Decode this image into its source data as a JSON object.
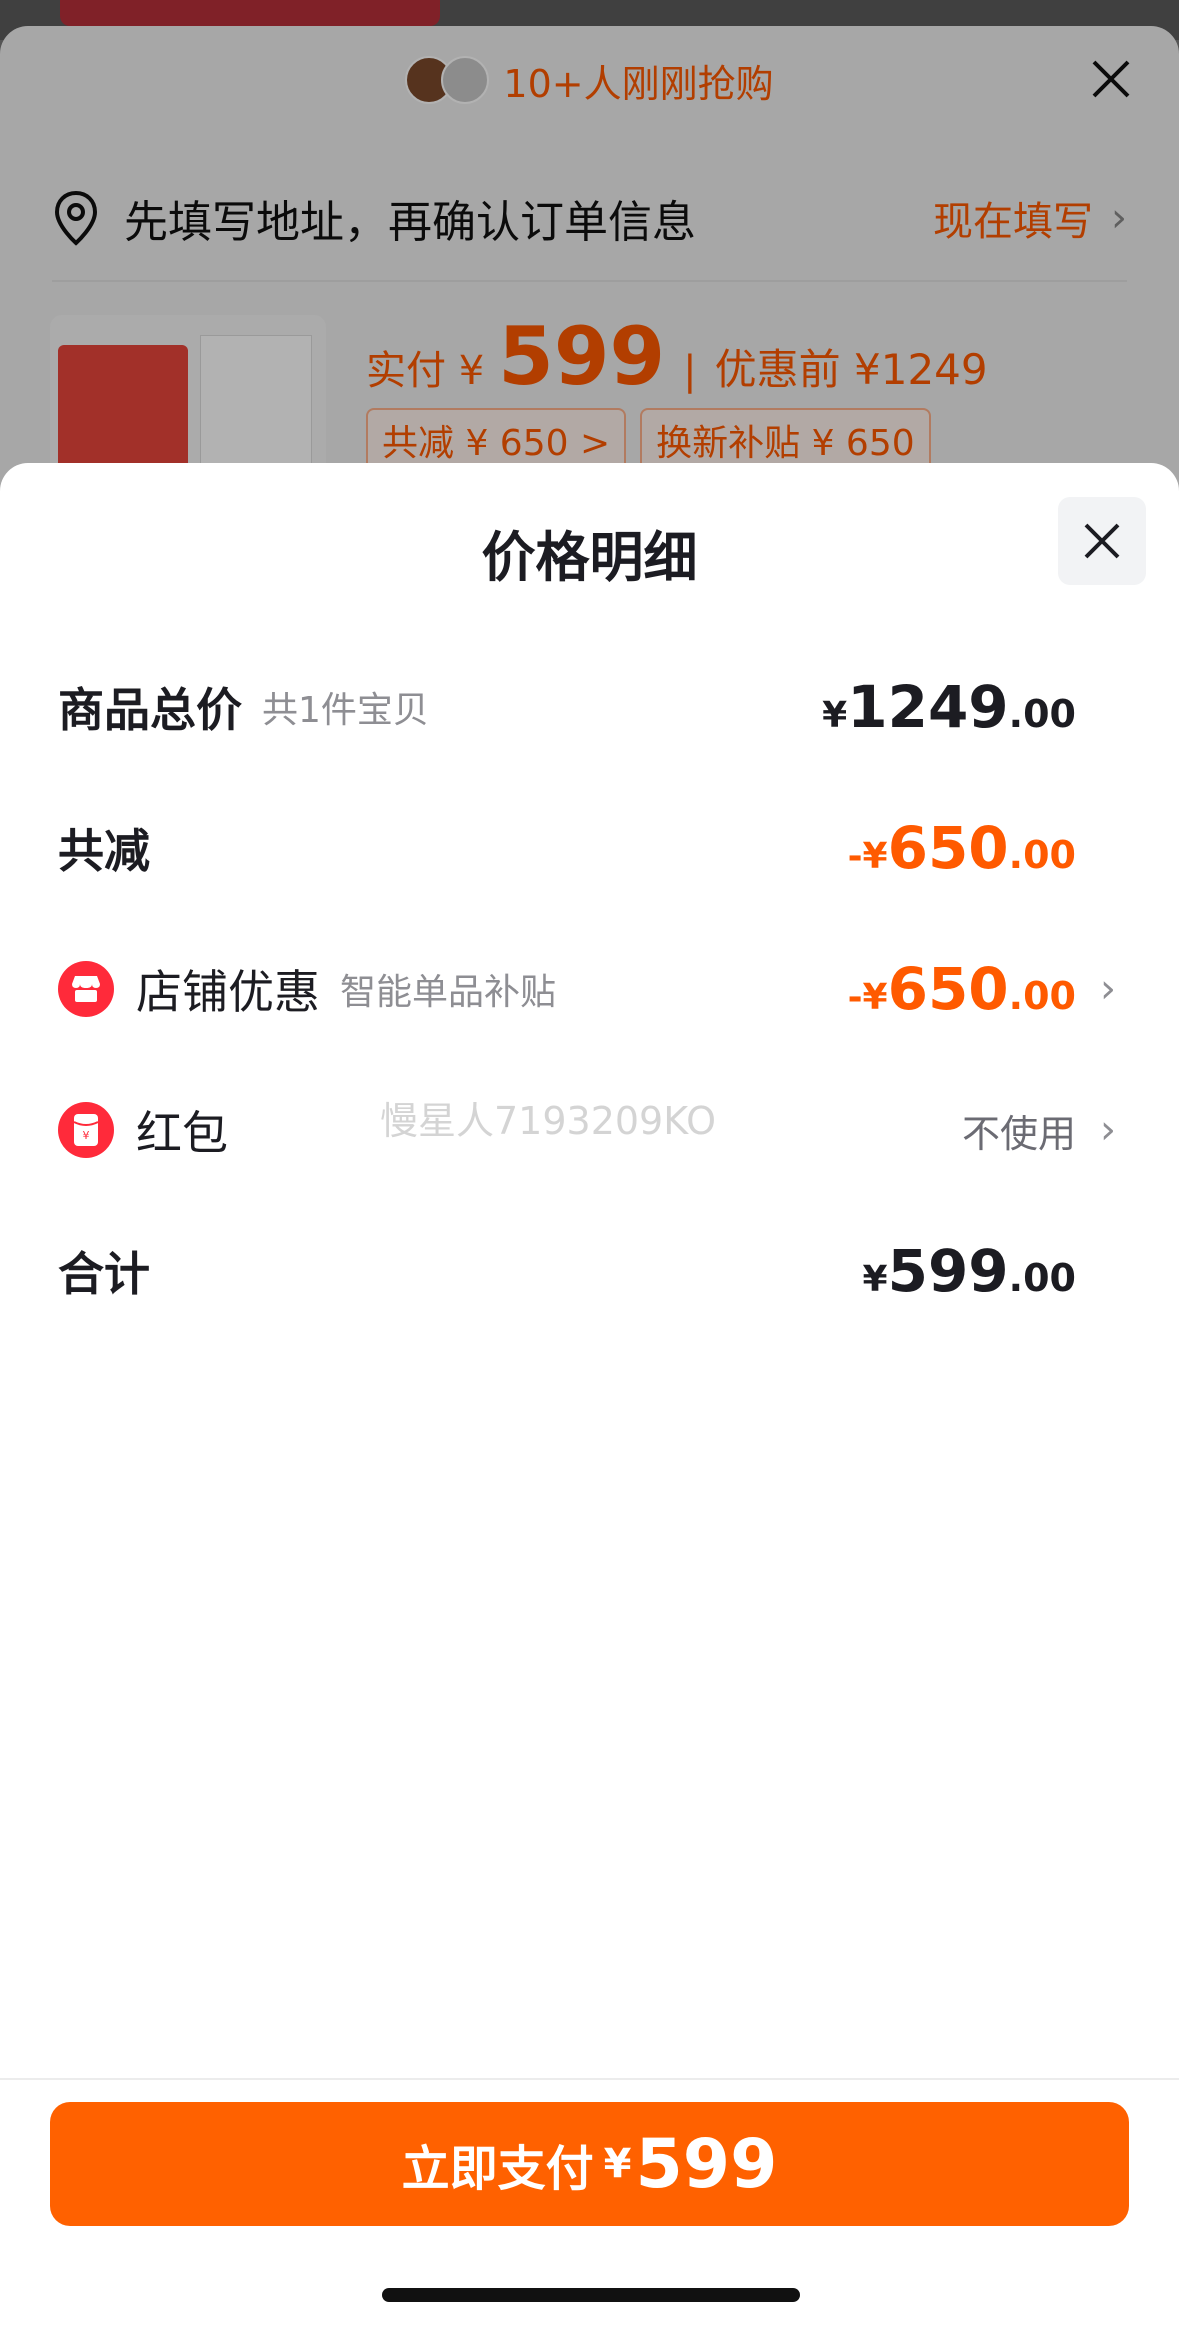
{
  "background": {
    "buyers_text": "10+人刚刚抢购",
    "address_prompt": "先填写地址，再确认订单信息",
    "address_action": "现在填写",
    "pay_label": "实付 ¥",
    "pay_value": "599",
    "before_label": "优惠前 ¥1249",
    "chip_discount": "共减 ¥ 650 >",
    "chip_subsidy": "换新补贴 ¥ 650"
  },
  "modal": {
    "title": "价格明细",
    "total": {
      "label": "商品总价",
      "sub": "共1件宝贝",
      "symbol": "¥",
      "int": "1249",
      "dec": ".00"
    },
    "reduce": {
      "label": "共减",
      "symbol": "-¥",
      "int": "650",
      "dec": ".00"
    },
    "shop": {
      "label": "店铺优惠",
      "sub": "智能单品补贴",
      "symbol": "-¥",
      "int": "650",
      "dec": ".00"
    },
    "redpacket": {
      "label": "红包",
      "value": "不使用"
    },
    "sum": {
      "label": "合计",
      "symbol": "¥",
      "int": "599",
      "dec": ".00"
    }
  },
  "watermark": "慢星人7193209KO",
  "footer": {
    "pay_label": "立即支付",
    "pay_symbol": "¥",
    "pay_amount": "599"
  },
  "colors": {
    "accent": "#ff6100",
    "discount": "#ff5a00",
    "icon_red": "#ff2a3a"
  }
}
